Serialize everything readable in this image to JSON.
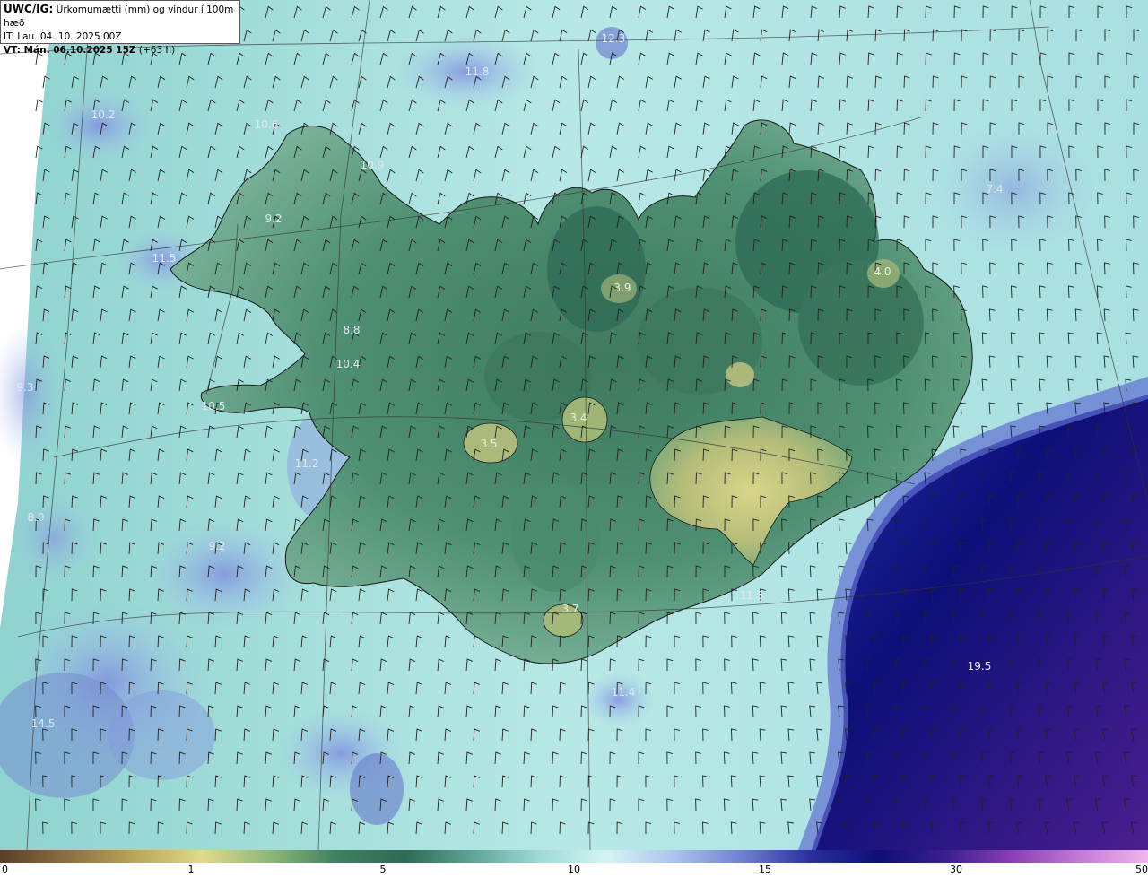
{
  "header": {
    "line1_bold": "UWC/IG:",
    "line1_text": " Úrkomumætti (mm) og vindur í 100m hæð",
    "line2": "IT: Lau. 04. 10. 2025 00Z",
    "line3_bold": "VT: Mán. 06.10.2025 15Z",
    "line3_text": " (+63 h)"
  },
  "map_labels": [
    "12.3",
    "11.8",
    "10.2",
    "10.6",
    "10.9",
    "7.4",
    "9.2",
    "11.5",
    "4.0",
    "3.9",
    "8.8",
    "10.4",
    "9.3",
    "10.5",
    "3.4",
    "3.5",
    "11.2",
    "8.0",
    "9.2",
    "3.7",
    "11.5",
    "19.5",
    "11.4",
    "14.5"
  ],
  "colorbar": {
    "ticks": [
      "0",
      "1",
      "5",
      "10",
      "15",
      "30",
      "50"
    ],
    "stops": [
      "#5a3f2a",
      "#8a7040",
      "#b9a65a",
      "#e2d98a",
      "#8fb77a",
      "#3f8060",
      "#2e6a55",
      "#5fa598",
      "#9fdcd6",
      "#d6f3f3",
      "#a9c4ee",
      "#6f7fd0",
      "#2a2f9e",
      "#0c0f75",
      "#3b1f8e",
      "#8a3fb5",
      "#c47ad6",
      "#f0b6ee"
    ],
    "colors": {
      "land_dark": "#2f6b52",
      "land_mid": "#4f8f70",
      "land_light": "#a8c47c",
      "sea": "#a6e0dc",
      "sea_light": "#cdeeee",
      "deep": "#13138a",
      "violet": "#5a2aa0"
    }
  }
}
